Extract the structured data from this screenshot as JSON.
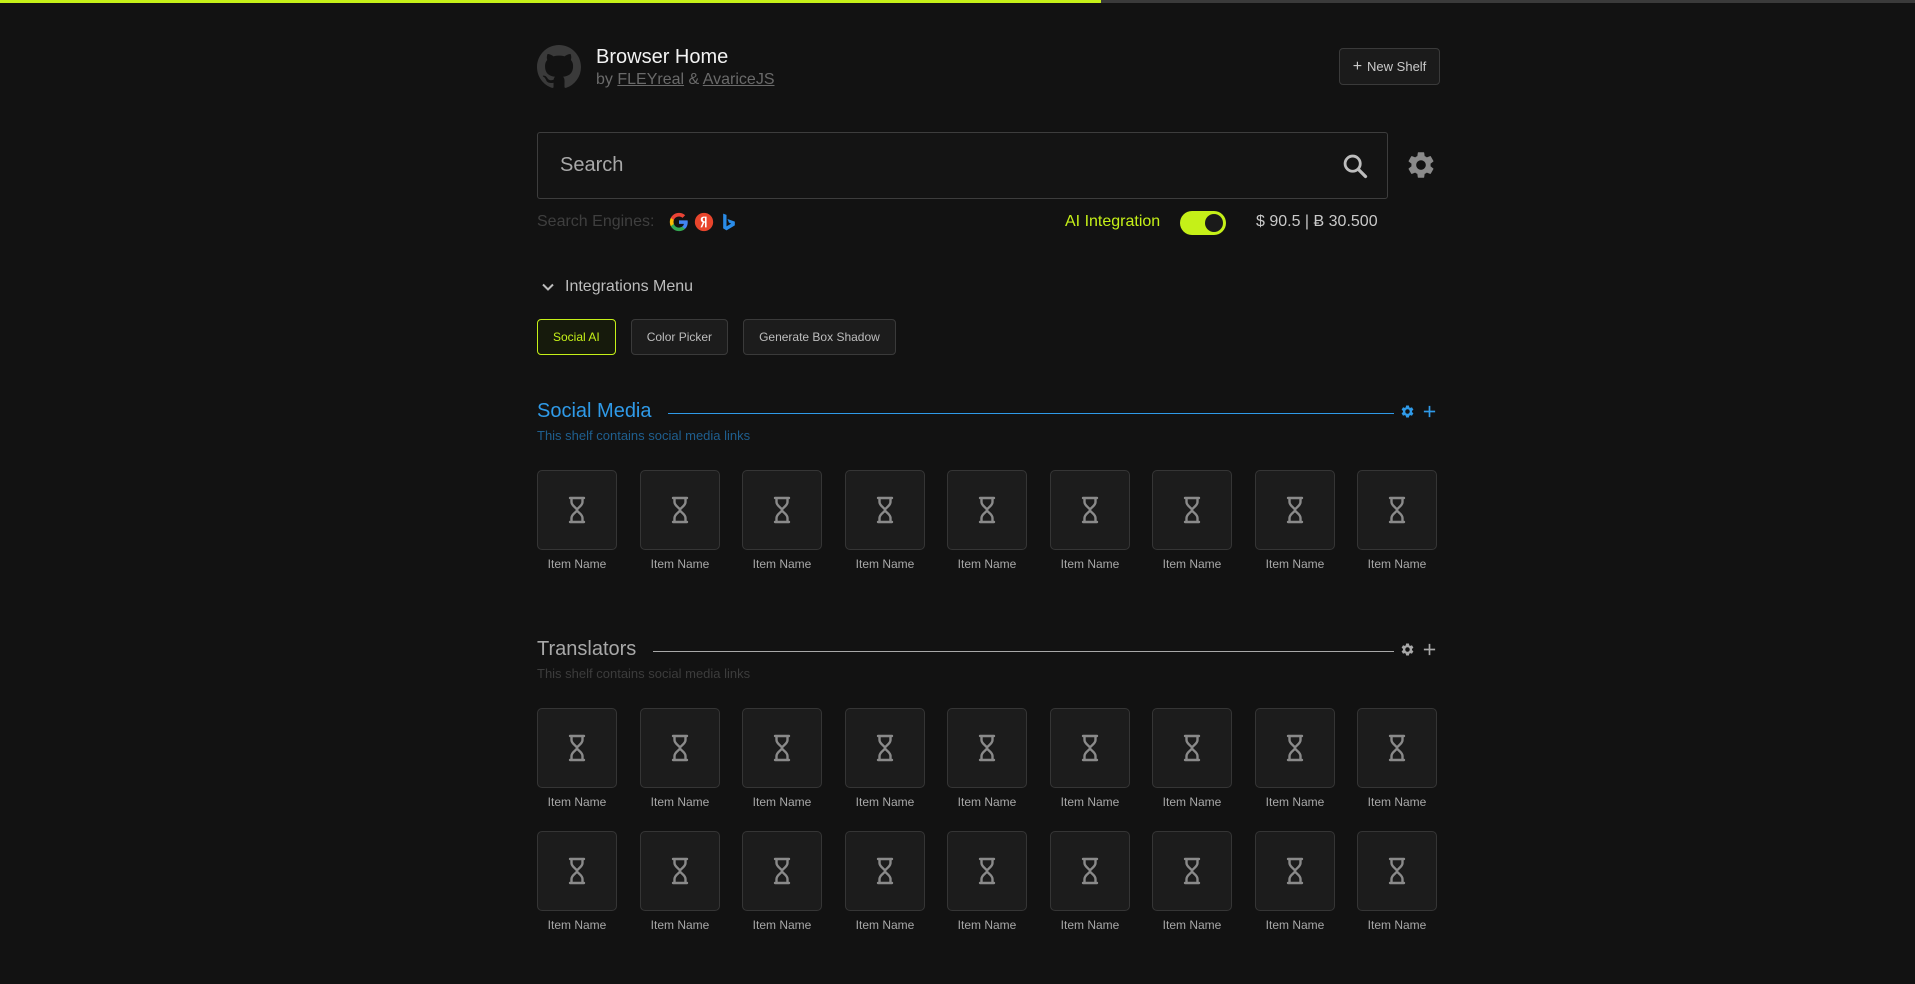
{
  "progress": {
    "fraction": 0.575,
    "fill_color": "#c5f018"
  },
  "header": {
    "title": "Browser Home",
    "by_prefix": "by",
    "author1": "FLEYreal",
    "amp": "&",
    "author2": "AvariceJS",
    "new_shelf_label": "New Shelf"
  },
  "search": {
    "placeholder": "Search"
  },
  "engines": {
    "label": "Search Engines:",
    "items": [
      "google-icon",
      "yandex-icon",
      "bing-icon"
    ]
  },
  "ai": {
    "label": "AI Integration",
    "enabled": true
  },
  "currency": "$ 90.5 | Ƀ 30.500",
  "integrations": {
    "menu_label": "Integrations Menu",
    "chips": [
      "Social AI",
      "Color Picker",
      "Generate Box Shadow"
    ],
    "active": "Social AI"
  },
  "shelves": [
    {
      "title": "Social Media",
      "description": "This shelf contains social media links",
      "color": "#2f9ae8",
      "desc_color": "#1f5f8f",
      "items": [
        "Item Name",
        "Item Name",
        "Item Name",
        "Item Name",
        "Item Name",
        "Item Name",
        "Item Name",
        "Item Name",
        "Item Name"
      ]
    },
    {
      "title": "Translators",
      "description": "This shelf contains social media links",
      "color": "#a8a8a8",
      "desc_color": "#3c3c3c",
      "items": [
        "Item Name",
        "Item Name",
        "Item Name",
        "Item Name",
        "Item Name",
        "Item Name",
        "Item Name",
        "Item Name",
        "Item Name",
        "Item Name",
        "Item Name",
        "Item Name",
        "Item Name",
        "Item Name",
        "Item Name",
        "Item Name",
        "Item Name",
        "Item Name"
      ]
    }
  ]
}
